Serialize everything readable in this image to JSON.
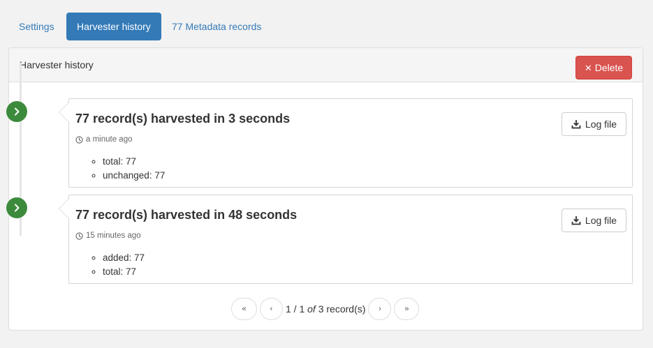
{
  "tabs": [
    {
      "label": "Settings",
      "active": false
    },
    {
      "label": "Harvester history",
      "active": true
    },
    {
      "label": "77 Metadata records",
      "active": false
    }
  ],
  "panel": {
    "title": "Harvester history",
    "delete_label": "Delete"
  },
  "history": [
    {
      "title_prefix": "77 record(s) harvested in",
      "duration": "3",
      "title_suffix": "seconds",
      "time": "a minute ago",
      "log_label": "Log file",
      "stats": [
        "total: 77",
        "unchanged: 77"
      ]
    },
    {
      "title_prefix": "77 record(s) harvested in",
      "duration": "48",
      "title_suffix": "seconds",
      "time": "15 minutes ago",
      "log_label": "Log file",
      "stats": [
        "added: 77",
        "total: 77"
      ]
    }
  ],
  "pagination": {
    "first": "«",
    "prev": "‹",
    "page": "1 / 1",
    "of": "of",
    "count": "3 record(s)",
    "next": "›",
    "last": "»"
  },
  "colors": {
    "primary": "#337ab7",
    "danger": "#d9534f",
    "success": "#3c8a3c"
  }
}
